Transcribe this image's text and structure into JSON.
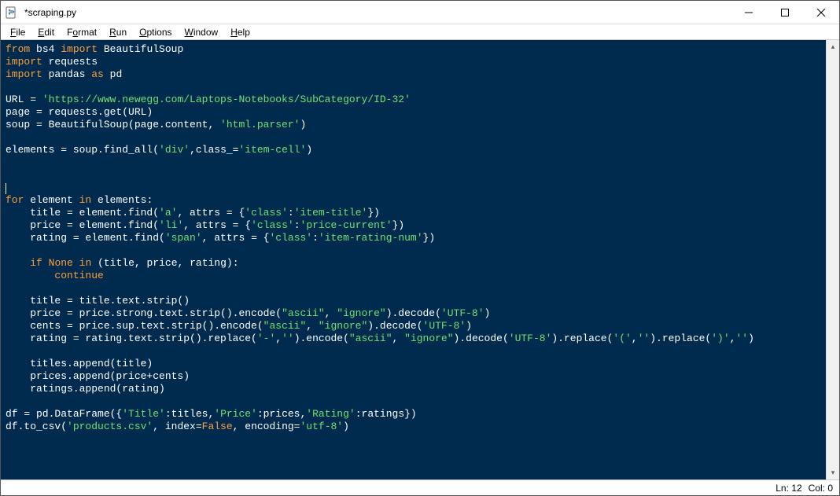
{
  "window": {
    "title": "*scraping.py"
  },
  "menu": {
    "file": {
      "label": "File",
      "accel": "F"
    },
    "edit": {
      "label": "Edit",
      "accel": "E"
    },
    "format": {
      "label": "Format",
      "accel": "o"
    },
    "run": {
      "label": "Run",
      "accel": "R"
    },
    "options": {
      "label": "Options",
      "accel": "O"
    },
    "window": {
      "label": "Window",
      "accel": "W"
    },
    "help": {
      "label": "Help",
      "accel": "H"
    }
  },
  "code": {
    "l1": {
      "a": "from",
      "b": " bs4 ",
      "c": "import",
      "d": " BeautifulSoup"
    },
    "l2": {
      "a": "import",
      "b": " requests"
    },
    "l3": {
      "a": "import",
      "b": " pandas ",
      "c": "as",
      "d": " pd"
    },
    "l5a": "URL = ",
    "l5b": "'https://www.newegg.com/Laptops-Notebooks/SubCategory/ID-32'",
    "l6": "page = requests.get(URL)",
    "l7a": "soup = BeautifulSoup(page.content, ",
    "l7b": "'html.parser'",
    "l7c": ")",
    "l9a": "elements = soup.find_all(",
    "l9b": "'div'",
    "l9c": ",class_=",
    "l9d": "'item-cell'",
    "l9e": ")",
    "l13": {
      "a": "for",
      "b": " element ",
      "c": "in",
      "d": " elements:"
    },
    "l14": {
      "a": "    title = element.find(",
      "b": "'a'",
      "c": ", attrs = {",
      "d": "'class'",
      "e": ":",
      "f": "'item-title'",
      "g": "})"
    },
    "l15": {
      "a": "    price = element.find(",
      "b": "'li'",
      "c": ", attrs = {",
      "d": "'class'",
      "e": ":",
      "f": "'price-current'",
      "g": "})"
    },
    "l16": {
      "a": "    rating = element.find(",
      "b": "'span'",
      "c": ", attrs = {",
      "d": "'class'",
      "e": ":",
      "f": "'item-rating-num'",
      "g": "})"
    },
    "l18": {
      "a": "    ",
      "b": "if",
      "c": " ",
      "d": "None",
      "e": " ",
      "f": "in",
      "g": " (title, price, rating):"
    },
    "l19": {
      "a": "        ",
      "b": "continue"
    },
    "l21": "    title = title.text.strip()",
    "l22": {
      "a": "    price = price.strong.text.strip().encode(",
      "b": "\"ascii\"",
      "c": ", ",
      "d": "\"ignore\"",
      "e": ").decode(",
      "f": "'UTF-8'",
      "g": ")"
    },
    "l23": {
      "a": "    cents = price.sup.text.strip().encode(",
      "b": "\"ascii\"",
      "c": ", ",
      "d": "\"ignore\"",
      "e": ").decode(",
      "f": "'UTF-8'",
      "g": ")"
    },
    "l24": {
      "a": "    rating = rating.text.strip().replace(",
      "b": "'-'",
      "c": ",",
      "d": "''",
      "e": ").encode(",
      "f": "\"ascii\"",
      "g": ", ",
      "h": "\"ignore\"",
      "i": ").decode(",
      "j": "'UTF-8'",
      "k": ").replace(",
      "l": "'('",
      "m": ",",
      "n": "''",
      "o": ").replace(",
      "p": "')'",
      "q": ",",
      "r": "''",
      "s": ")"
    },
    "l26": "    titles.append(title)",
    "l27": "    prices.append(price+cents)",
    "l28": "    ratings.append(rating)",
    "l30": {
      "a": "df = pd.DataFrame({",
      "b": "'Title'",
      "c": ":titles,",
      "d": "'Price'",
      "e": ":prices,",
      "f": "'Rating'",
      "g": ":ratings})"
    },
    "l31": {
      "a": "df.to_csv(",
      "b": "'products.csv'",
      "c": ", index=",
      "d": "False",
      "e": ", encoding=",
      "f": "'utf-8'",
      "g": ")"
    }
  },
  "status": {
    "ln_label": "Ln:",
    "ln": "12",
    "col_label": "Col:",
    "col": "0"
  }
}
